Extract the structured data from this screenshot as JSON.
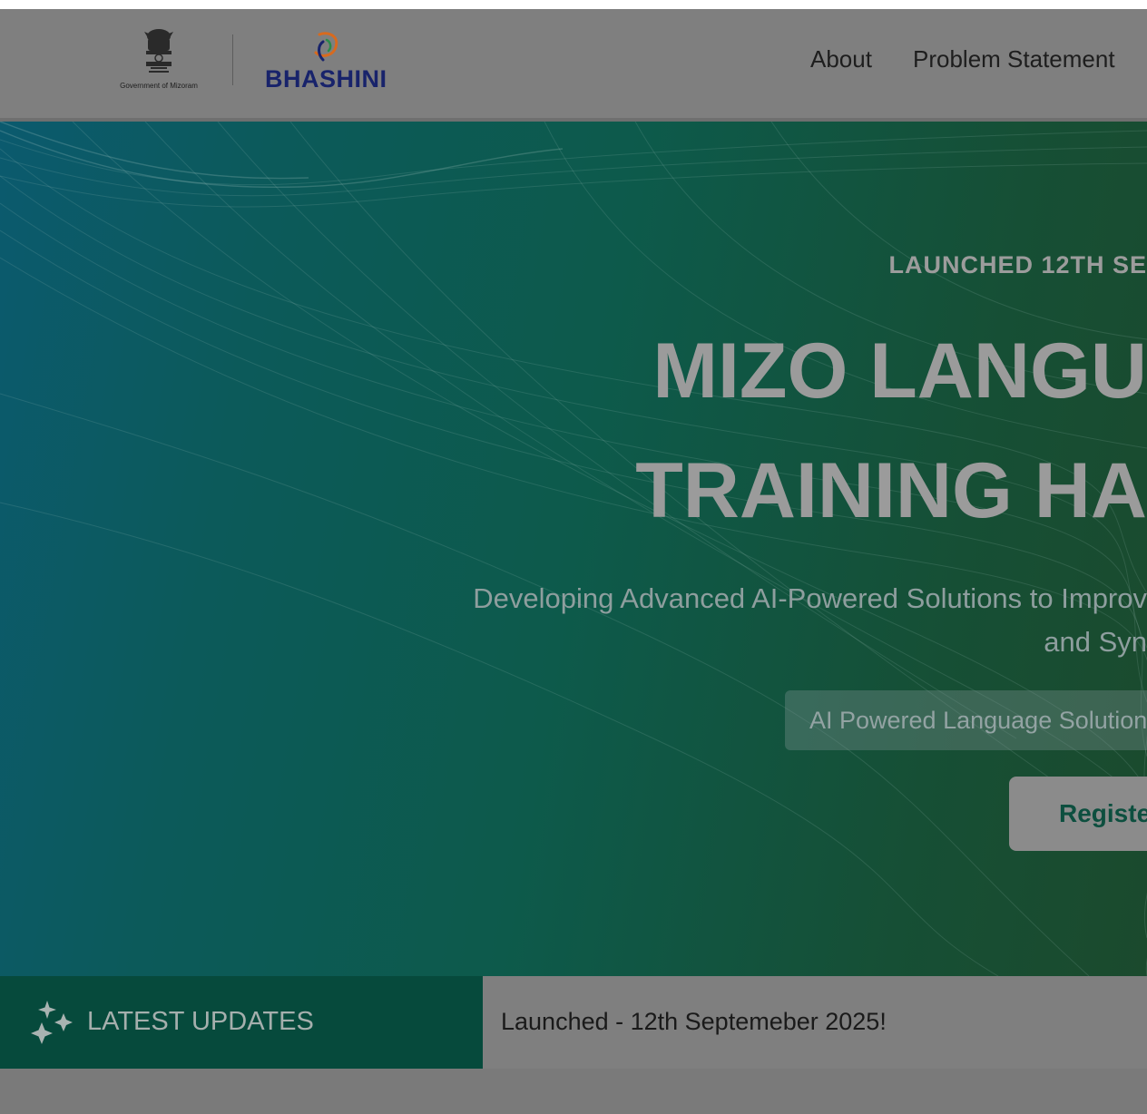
{
  "header": {
    "emblem_caption": "Government of Mizoram",
    "brand_name": "BHASHINI",
    "nav_items": [
      {
        "label": "About"
      },
      {
        "label": "Problem Statement"
      }
    ]
  },
  "hero": {
    "eyebrow": "LAUNCHED 12TH SE",
    "title_line_1": "MIZO LANGU",
    "title_line_2": "TRAINING HA",
    "subtitle_line_1": "Developing Advanced AI-Powered Solutions to Improv",
    "subtitle_line_2": "and Syn",
    "pill_text": "AI Powered Language Solution",
    "register_label": "Registe"
  },
  "updates": {
    "tag_label": "LATEST UPDATES",
    "ticker_text": "Launched - 12th Septemeber 2025!"
  },
  "colors": {
    "hero_teal": "#0b5a6e",
    "hero_green": "#1b4a2d",
    "updates_tag_bg": "#064a3c",
    "register_text": "#0d4f3f",
    "brand_navy": "#18236b",
    "brand_orange": "#d86a1e"
  },
  "icons": {
    "emblem": "national-emblem-icon",
    "brand_logo": "bhashini-swirl-icon",
    "updates": "sparkle-icon"
  }
}
